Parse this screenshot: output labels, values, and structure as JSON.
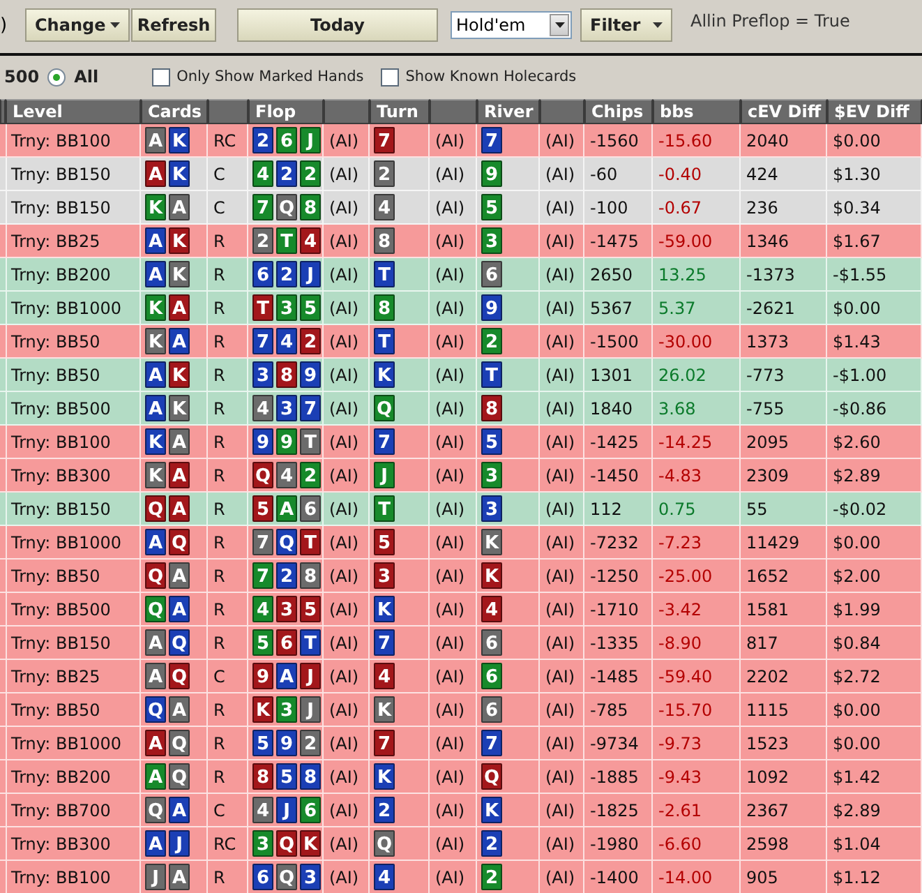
{
  "toolbar": {
    "partial_text": ")",
    "change_button": "Change",
    "refresh_button": "Refresh",
    "today_button": "Today",
    "game_select": {
      "value": "Hold'em"
    },
    "filter_button": "Filter",
    "filter_summary": "Allin Preflop = True"
  },
  "options": {
    "count_label": "500",
    "all_radio": {
      "label": "All",
      "selected": true
    },
    "checkboxes": [
      {
        "label": "Only Show Marked Hands",
        "checked": false
      },
      {
        "label": "Show Known Holecards",
        "checked": false
      }
    ]
  },
  "table": {
    "columns": {
      "level": "Level",
      "cards": "Cards",
      "flop": "Flop",
      "turn": "Turn",
      "river": "River",
      "chips": "Chips",
      "bbs": "bbs",
      "cev_diff": "cEV Diff",
      "ev_diff": "$EV Diff"
    },
    "rows": [
      {
        "kind": "loss",
        "level": "Trny: BB100",
        "cards": [
          {
            "rank": "A",
            "color": "#6b6b6b"
          },
          {
            "rank": "K",
            "color": "#1b3fb5"
          }
        ],
        "action": "RC",
        "flop": [
          {
            "rank": "2",
            "color": "#1b3fb5"
          },
          {
            "rank": "6",
            "color": "#178a2b"
          },
          {
            "rank": "J",
            "color": "#178a2b"
          }
        ],
        "flop_tag": "(AI)",
        "turn": {
          "rank": "7",
          "color": "#a3171b"
        },
        "turn_tag": "(AI)",
        "river": {
          "rank": "7",
          "color": "#1b3fb5"
        },
        "river_tag": "(AI)",
        "chips": "-1560",
        "bbs": "-15.60",
        "cev_diff": "2040",
        "ev_diff": "$0.00"
      },
      {
        "kind": "even",
        "level": "Trny: BB150",
        "cards": [
          {
            "rank": "A",
            "color": "#a3171b"
          },
          {
            "rank": "K",
            "color": "#1b3fb5"
          }
        ],
        "action": "C",
        "flop": [
          {
            "rank": "4",
            "color": "#178a2b"
          },
          {
            "rank": "2",
            "color": "#1b3fb5"
          },
          {
            "rank": "2",
            "color": "#178a2b"
          }
        ],
        "flop_tag": "(AI)",
        "turn": {
          "rank": "2",
          "color": "#6b6b6b"
        },
        "turn_tag": "(AI)",
        "river": {
          "rank": "9",
          "color": "#178a2b"
        },
        "river_tag": "(AI)",
        "chips": "-60",
        "bbs": "-0.40",
        "cev_diff": "424",
        "ev_diff": "$1.30"
      },
      {
        "kind": "even",
        "level": "Trny: BB150",
        "cards": [
          {
            "rank": "K",
            "color": "#178a2b"
          },
          {
            "rank": "A",
            "color": "#6b6b6b"
          }
        ],
        "action": "C",
        "flop": [
          {
            "rank": "7",
            "color": "#178a2b"
          },
          {
            "rank": "Q",
            "color": "#6b6b6b"
          },
          {
            "rank": "8",
            "color": "#178a2b"
          }
        ],
        "flop_tag": "(AI)",
        "turn": {
          "rank": "4",
          "color": "#6b6b6b"
        },
        "turn_tag": "(AI)",
        "river": {
          "rank": "5",
          "color": "#178a2b"
        },
        "river_tag": "(AI)",
        "chips": "-100",
        "bbs": "-0.67",
        "cev_diff": "236",
        "ev_diff": "$0.34"
      },
      {
        "kind": "loss",
        "level": "Trny: BB25",
        "cards": [
          {
            "rank": "A",
            "color": "#1b3fb5"
          },
          {
            "rank": "K",
            "color": "#a3171b"
          }
        ],
        "action": "R",
        "flop": [
          {
            "rank": "2",
            "color": "#6b6b6b"
          },
          {
            "rank": "T",
            "color": "#178a2b"
          },
          {
            "rank": "4",
            "color": "#a3171b"
          }
        ],
        "flop_tag": "(AI)",
        "turn": {
          "rank": "8",
          "color": "#6b6b6b"
        },
        "turn_tag": "(AI)",
        "river": {
          "rank": "3",
          "color": "#178a2b"
        },
        "river_tag": "(AI)",
        "chips": "-1475",
        "bbs": "-59.00",
        "cev_diff": "1346",
        "ev_diff": "$1.67"
      },
      {
        "kind": "win",
        "level": "Trny: BB200",
        "cards": [
          {
            "rank": "A",
            "color": "#1b3fb5"
          },
          {
            "rank": "K",
            "color": "#6b6b6b"
          }
        ],
        "action": "R",
        "flop": [
          {
            "rank": "6",
            "color": "#1b3fb5"
          },
          {
            "rank": "2",
            "color": "#1b3fb5"
          },
          {
            "rank": "J",
            "color": "#1b3fb5"
          }
        ],
        "flop_tag": "(AI)",
        "turn": {
          "rank": "T",
          "color": "#1b3fb5"
        },
        "turn_tag": "(AI)",
        "river": {
          "rank": "6",
          "color": "#6b6b6b"
        },
        "river_tag": "(AI)",
        "chips": "2650",
        "bbs": "13.25",
        "cev_diff": "-1373",
        "ev_diff": "-$1.55"
      },
      {
        "kind": "win",
        "level": "Trny: BB1000",
        "cards": [
          {
            "rank": "K",
            "color": "#178a2b"
          },
          {
            "rank": "A",
            "color": "#a3171b"
          }
        ],
        "action": "R",
        "flop": [
          {
            "rank": "T",
            "color": "#a3171b"
          },
          {
            "rank": "3",
            "color": "#178a2b"
          },
          {
            "rank": "5",
            "color": "#178a2b"
          }
        ],
        "flop_tag": "(AI)",
        "turn": {
          "rank": "8",
          "color": "#178a2b"
        },
        "turn_tag": "(AI)",
        "river": {
          "rank": "9",
          "color": "#1b3fb5"
        },
        "river_tag": "(AI)",
        "chips": "5367",
        "bbs": "5.37",
        "cev_diff": "-2621",
        "ev_diff": "$0.00"
      },
      {
        "kind": "loss",
        "level": "Trny: BB50",
        "cards": [
          {
            "rank": "K",
            "color": "#6b6b6b"
          },
          {
            "rank": "A",
            "color": "#1b3fb5"
          }
        ],
        "action": "R",
        "flop": [
          {
            "rank": "7",
            "color": "#1b3fb5"
          },
          {
            "rank": "4",
            "color": "#1b3fb5"
          },
          {
            "rank": "2",
            "color": "#a3171b"
          }
        ],
        "flop_tag": "(AI)",
        "turn": {
          "rank": "T",
          "color": "#1b3fb5"
        },
        "turn_tag": "(AI)",
        "river": {
          "rank": "2",
          "color": "#178a2b"
        },
        "river_tag": "(AI)",
        "chips": "-1500",
        "bbs": "-30.00",
        "cev_diff": "1373",
        "ev_diff": "$1.43"
      },
      {
        "kind": "win",
        "level": "Trny: BB50",
        "cards": [
          {
            "rank": "A",
            "color": "#1b3fb5"
          },
          {
            "rank": "K",
            "color": "#a3171b"
          }
        ],
        "action": "R",
        "flop": [
          {
            "rank": "3",
            "color": "#1b3fb5"
          },
          {
            "rank": "8",
            "color": "#a3171b"
          },
          {
            "rank": "9",
            "color": "#1b3fb5"
          }
        ],
        "flop_tag": "(AI)",
        "turn": {
          "rank": "K",
          "color": "#1b3fb5"
        },
        "turn_tag": "(AI)",
        "river": {
          "rank": "T",
          "color": "#1b3fb5"
        },
        "river_tag": "(AI)",
        "chips": "1301",
        "bbs": "26.02",
        "cev_diff": "-773",
        "ev_diff": "-$1.00"
      },
      {
        "kind": "win",
        "level": "Trny: BB500",
        "cards": [
          {
            "rank": "A",
            "color": "#1b3fb5"
          },
          {
            "rank": "K",
            "color": "#6b6b6b"
          }
        ],
        "action": "R",
        "flop": [
          {
            "rank": "4",
            "color": "#6b6b6b"
          },
          {
            "rank": "3",
            "color": "#1b3fb5"
          },
          {
            "rank": "7",
            "color": "#1b3fb5"
          }
        ],
        "flop_tag": "(AI)",
        "turn": {
          "rank": "Q",
          "color": "#178a2b"
        },
        "turn_tag": "(AI)",
        "river": {
          "rank": "8",
          "color": "#a3171b"
        },
        "river_tag": "(AI)",
        "chips": "1840",
        "bbs": "3.68",
        "cev_diff": "-755",
        "ev_diff": "-$0.86"
      },
      {
        "kind": "loss",
        "level": "Trny: BB100",
        "cards": [
          {
            "rank": "K",
            "color": "#1b3fb5"
          },
          {
            "rank": "A",
            "color": "#6b6b6b"
          }
        ],
        "action": "R",
        "flop": [
          {
            "rank": "9",
            "color": "#1b3fb5"
          },
          {
            "rank": "9",
            "color": "#178a2b"
          },
          {
            "rank": "T",
            "color": "#6b6b6b"
          }
        ],
        "flop_tag": "(AI)",
        "turn": {
          "rank": "7",
          "color": "#1b3fb5"
        },
        "turn_tag": "(AI)",
        "river": {
          "rank": "5",
          "color": "#1b3fb5"
        },
        "river_tag": "(AI)",
        "chips": "-1425",
        "bbs": "-14.25",
        "cev_diff": "2095",
        "ev_diff": "$2.60"
      },
      {
        "kind": "loss",
        "level": "Trny: BB300",
        "cards": [
          {
            "rank": "K",
            "color": "#6b6b6b"
          },
          {
            "rank": "A",
            "color": "#a3171b"
          }
        ],
        "action": "R",
        "flop": [
          {
            "rank": "Q",
            "color": "#a3171b"
          },
          {
            "rank": "4",
            "color": "#6b6b6b"
          },
          {
            "rank": "2",
            "color": "#178a2b"
          }
        ],
        "flop_tag": "(AI)",
        "turn": {
          "rank": "J",
          "color": "#178a2b"
        },
        "turn_tag": "(AI)",
        "river": {
          "rank": "3",
          "color": "#178a2b"
        },
        "river_tag": "(AI)",
        "chips": "-1450",
        "bbs": "-4.83",
        "cev_diff": "2309",
        "ev_diff": "$2.89"
      },
      {
        "kind": "win",
        "level": "Trny: BB150",
        "cards": [
          {
            "rank": "Q",
            "color": "#a3171b"
          },
          {
            "rank": "A",
            "color": "#a3171b"
          }
        ],
        "action": "R",
        "flop": [
          {
            "rank": "5",
            "color": "#a3171b"
          },
          {
            "rank": "A",
            "color": "#178a2b"
          },
          {
            "rank": "6",
            "color": "#6b6b6b"
          }
        ],
        "flop_tag": "(AI)",
        "turn": {
          "rank": "T",
          "color": "#178a2b"
        },
        "turn_tag": "(AI)",
        "river": {
          "rank": "3",
          "color": "#1b3fb5"
        },
        "river_tag": "(AI)",
        "chips": "112",
        "bbs": "0.75",
        "cev_diff": "55",
        "ev_diff": "-$0.02"
      },
      {
        "kind": "loss",
        "level": "Trny: BB1000",
        "cards": [
          {
            "rank": "A",
            "color": "#1b3fb5"
          },
          {
            "rank": "Q",
            "color": "#a3171b"
          }
        ],
        "action": "R",
        "flop": [
          {
            "rank": "7",
            "color": "#6b6b6b"
          },
          {
            "rank": "Q",
            "color": "#1b3fb5"
          },
          {
            "rank": "T",
            "color": "#a3171b"
          }
        ],
        "flop_tag": "(AI)",
        "turn": {
          "rank": "5",
          "color": "#a3171b"
        },
        "turn_tag": "(AI)",
        "river": {
          "rank": "K",
          "color": "#6b6b6b"
        },
        "river_tag": "(AI)",
        "chips": "-7232",
        "bbs": "-7.23",
        "cev_diff": "11429",
        "ev_diff": "$0.00"
      },
      {
        "kind": "loss",
        "level": "Trny: BB50",
        "cards": [
          {
            "rank": "Q",
            "color": "#a3171b"
          },
          {
            "rank": "A",
            "color": "#6b6b6b"
          }
        ],
        "action": "R",
        "flop": [
          {
            "rank": "7",
            "color": "#178a2b"
          },
          {
            "rank": "2",
            "color": "#1b3fb5"
          },
          {
            "rank": "8",
            "color": "#6b6b6b"
          }
        ],
        "flop_tag": "(AI)",
        "turn": {
          "rank": "3",
          "color": "#a3171b"
        },
        "turn_tag": "(AI)",
        "river": {
          "rank": "K",
          "color": "#a3171b"
        },
        "river_tag": "(AI)",
        "chips": "-1250",
        "bbs": "-25.00",
        "cev_diff": "1652",
        "ev_diff": "$2.00"
      },
      {
        "kind": "loss",
        "level": "Trny: BB500",
        "cards": [
          {
            "rank": "Q",
            "color": "#178a2b"
          },
          {
            "rank": "A",
            "color": "#1b3fb5"
          }
        ],
        "action": "R",
        "flop": [
          {
            "rank": "4",
            "color": "#178a2b"
          },
          {
            "rank": "3",
            "color": "#a3171b"
          },
          {
            "rank": "5",
            "color": "#a3171b"
          }
        ],
        "flop_tag": "(AI)",
        "turn": {
          "rank": "K",
          "color": "#1b3fb5"
        },
        "turn_tag": "(AI)",
        "river": {
          "rank": "4",
          "color": "#a3171b"
        },
        "river_tag": "(AI)",
        "chips": "-1710",
        "bbs": "-3.42",
        "cev_diff": "1581",
        "ev_diff": "$1.99"
      },
      {
        "kind": "loss",
        "level": "Trny: BB150",
        "cards": [
          {
            "rank": "A",
            "color": "#6b6b6b"
          },
          {
            "rank": "Q",
            "color": "#1b3fb5"
          }
        ],
        "action": "R",
        "flop": [
          {
            "rank": "5",
            "color": "#178a2b"
          },
          {
            "rank": "6",
            "color": "#a3171b"
          },
          {
            "rank": "T",
            "color": "#1b3fb5"
          }
        ],
        "flop_tag": "(AI)",
        "turn": {
          "rank": "7",
          "color": "#1b3fb5"
        },
        "turn_tag": "(AI)",
        "river": {
          "rank": "6",
          "color": "#6b6b6b"
        },
        "river_tag": "(AI)",
        "chips": "-1335",
        "bbs": "-8.90",
        "cev_diff": "817",
        "ev_diff": "$0.84"
      },
      {
        "kind": "loss",
        "level": "Trny: BB25",
        "cards": [
          {
            "rank": "A",
            "color": "#6b6b6b"
          },
          {
            "rank": "Q",
            "color": "#a3171b"
          }
        ],
        "action": "C",
        "flop": [
          {
            "rank": "9",
            "color": "#a3171b"
          },
          {
            "rank": "A",
            "color": "#1b3fb5"
          },
          {
            "rank": "J",
            "color": "#a3171b"
          }
        ],
        "flop_tag": "(AI)",
        "turn": {
          "rank": "4",
          "color": "#a3171b"
        },
        "turn_tag": "(AI)",
        "river": {
          "rank": "6",
          "color": "#178a2b"
        },
        "river_tag": "(AI)",
        "chips": "-1485",
        "bbs": "-59.40",
        "cev_diff": "2202",
        "ev_diff": "$2.72"
      },
      {
        "kind": "loss",
        "level": "Trny: BB50",
        "cards": [
          {
            "rank": "Q",
            "color": "#1b3fb5"
          },
          {
            "rank": "A",
            "color": "#6b6b6b"
          }
        ],
        "action": "R",
        "flop": [
          {
            "rank": "K",
            "color": "#a3171b"
          },
          {
            "rank": "3",
            "color": "#178a2b"
          },
          {
            "rank": "J",
            "color": "#6b6b6b"
          }
        ],
        "flop_tag": "(AI)",
        "turn": {
          "rank": "K",
          "color": "#6b6b6b"
        },
        "turn_tag": "(AI)",
        "river": {
          "rank": "6",
          "color": "#6b6b6b"
        },
        "river_tag": "(AI)",
        "chips": "-785",
        "bbs": "-15.70",
        "cev_diff": "1115",
        "ev_diff": "$0.00"
      },
      {
        "kind": "loss",
        "level": "Trny: BB1000",
        "cards": [
          {
            "rank": "A",
            "color": "#a3171b"
          },
          {
            "rank": "Q",
            "color": "#6b6b6b"
          }
        ],
        "action": "R",
        "flop": [
          {
            "rank": "5",
            "color": "#1b3fb5"
          },
          {
            "rank": "9",
            "color": "#1b3fb5"
          },
          {
            "rank": "2",
            "color": "#6b6b6b"
          }
        ],
        "flop_tag": "(AI)",
        "turn": {
          "rank": "7",
          "color": "#a3171b"
        },
        "turn_tag": "(AI)",
        "river": {
          "rank": "7",
          "color": "#1b3fb5"
        },
        "river_tag": "(AI)",
        "chips": "-9734",
        "bbs": "-9.73",
        "cev_diff": "1523",
        "ev_diff": "$0.00"
      },
      {
        "kind": "loss",
        "level": "Trny: BB200",
        "cards": [
          {
            "rank": "A",
            "color": "#178a2b"
          },
          {
            "rank": "Q",
            "color": "#6b6b6b"
          }
        ],
        "action": "R",
        "flop": [
          {
            "rank": "8",
            "color": "#a3171b"
          },
          {
            "rank": "5",
            "color": "#1b3fb5"
          },
          {
            "rank": "8",
            "color": "#1b3fb5"
          }
        ],
        "flop_tag": "(AI)",
        "turn": {
          "rank": "K",
          "color": "#1b3fb5"
        },
        "turn_tag": "(AI)",
        "river": {
          "rank": "Q",
          "color": "#a3171b"
        },
        "river_tag": "(AI)",
        "chips": "-1885",
        "bbs": "-9.43",
        "cev_diff": "1092",
        "ev_diff": "$1.42"
      },
      {
        "kind": "loss",
        "level": "Trny: BB700",
        "cards": [
          {
            "rank": "Q",
            "color": "#6b6b6b"
          },
          {
            "rank": "A",
            "color": "#1b3fb5"
          }
        ],
        "action": "C",
        "flop": [
          {
            "rank": "4",
            "color": "#6b6b6b"
          },
          {
            "rank": "J",
            "color": "#1b3fb5"
          },
          {
            "rank": "6",
            "color": "#178a2b"
          }
        ],
        "flop_tag": "(AI)",
        "turn": {
          "rank": "2",
          "color": "#1b3fb5"
        },
        "turn_tag": "(AI)",
        "river": {
          "rank": "K",
          "color": "#1b3fb5"
        },
        "river_tag": "(AI)",
        "chips": "-1825",
        "bbs": "-2.61",
        "cev_diff": "2367",
        "ev_diff": "$2.89"
      },
      {
        "kind": "loss",
        "level": "Trny: BB300",
        "cards": [
          {
            "rank": "A",
            "color": "#1b3fb5"
          },
          {
            "rank": "J",
            "color": "#1b3fb5"
          }
        ],
        "action": "RC",
        "flop": [
          {
            "rank": "3",
            "color": "#178a2b"
          },
          {
            "rank": "Q",
            "color": "#a3171b"
          },
          {
            "rank": "K",
            "color": "#a3171b"
          }
        ],
        "flop_tag": "(AI)",
        "turn": {
          "rank": "Q",
          "color": "#6b6b6b"
        },
        "turn_tag": "(AI)",
        "river": {
          "rank": "2",
          "color": "#1b3fb5"
        },
        "river_tag": "(AI)",
        "chips": "-1980",
        "bbs": "-6.60",
        "cev_diff": "2598",
        "ev_diff": "$1.04"
      },
      {
        "kind": "loss",
        "level": "Trny: BB100",
        "cards": [
          {
            "rank": "J",
            "color": "#6b6b6b"
          },
          {
            "rank": "A",
            "color": "#6b6b6b"
          }
        ],
        "action": "R",
        "flop": [
          {
            "rank": "6",
            "color": "#1b3fb5"
          },
          {
            "rank": "Q",
            "color": "#6b6b6b"
          },
          {
            "rank": "3",
            "color": "#1b3fb5"
          }
        ],
        "flop_tag": "(AI)",
        "turn": {
          "rank": "4",
          "color": "#1b3fb5"
        },
        "turn_tag": "(AI)",
        "river": {
          "rank": "2",
          "color": "#178a2b"
        },
        "river_tag": "(AI)",
        "chips": "-1400",
        "bbs": "-14.00",
        "cev_diff": "905",
        "ev_diff": "$1.12"
      }
    ]
  }
}
